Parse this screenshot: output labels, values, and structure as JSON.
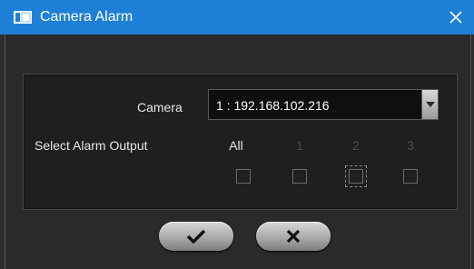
{
  "window": {
    "title": "Camera Alarm",
    "close_icon": "close-icon",
    "app_icon": "camera-window-icon",
    "titlebar_color": "#1e7fd6"
  },
  "form": {
    "camera_label": "Camera",
    "camera_value": "1 : 192.168.102.216",
    "alarm_output_label": "Select Alarm Output",
    "outputs": [
      {
        "label": "All",
        "checked": false,
        "enabled": true
      },
      {
        "label": "1",
        "checked": false,
        "enabled": false
      },
      {
        "label": "2",
        "checked": false,
        "enabled": false,
        "focused": true
      },
      {
        "label": "3",
        "checked": false,
        "enabled": false
      }
    ]
  },
  "buttons": {
    "ok_icon": "checkmark-icon",
    "cancel_icon": "x-icon"
  }
}
